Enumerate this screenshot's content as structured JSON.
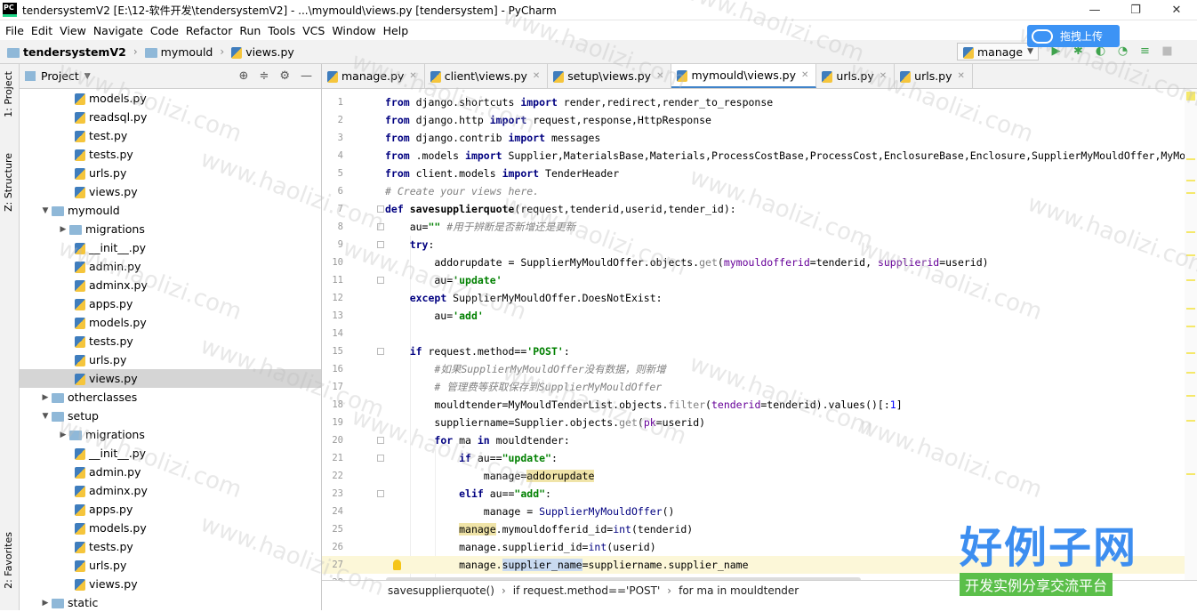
{
  "window": {
    "title": "tendersystemV2 [E:\\12-软件开发\\tendersystemV2] - ...\\mymould\\views.py [tendersystem] - PyCharm",
    "logo_text": "PC"
  },
  "menu": [
    "File",
    "Edit",
    "View",
    "Navigate",
    "Code",
    "Refactor",
    "Run",
    "Tools",
    "VCS",
    "Window",
    "Help"
  ],
  "navbar": {
    "crumbs": [
      "tendersystemV2",
      "mymould",
      "views.py"
    ],
    "run_config": "manage",
    "upload_badge": "拖拽上传"
  },
  "left_strip": {
    "tabs": [
      "1: Project",
      "Z: Structure",
      "2: Favorites"
    ]
  },
  "project_panel": {
    "title": "Project",
    "tree": [
      {
        "label": "models.py",
        "indent": 3,
        "type": "py"
      },
      {
        "label": "readsql.py",
        "indent": 3,
        "type": "py"
      },
      {
        "label": "test.py",
        "indent": 3,
        "type": "py"
      },
      {
        "label": "tests.py",
        "indent": 3,
        "type": "py"
      },
      {
        "label": "urls.py",
        "indent": 3,
        "type": "py"
      },
      {
        "label": "views.py",
        "indent": 3,
        "type": "py"
      },
      {
        "label": "mymould",
        "indent": 1,
        "type": "folder",
        "arrow": "open"
      },
      {
        "label": "migrations",
        "indent": 2,
        "type": "folder",
        "arrow": "closed"
      },
      {
        "label": "__init__.py",
        "indent": 3,
        "type": "py"
      },
      {
        "label": "admin.py",
        "indent": 3,
        "type": "py"
      },
      {
        "label": "adminx.py",
        "indent": 3,
        "type": "py"
      },
      {
        "label": "apps.py",
        "indent": 3,
        "type": "py"
      },
      {
        "label": "models.py",
        "indent": 3,
        "type": "py"
      },
      {
        "label": "tests.py",
        "indent": 3,
        "type": "py"
      },
      {
        "label": "urls.py",
        "indent": 3,
        "type": "py"
      },
      {
        "label": "views.py",
        "indent": 3,
        "type": "py",
        "selected": true
      },
      {
        "label": "otherclasses",
        "indent": 1,
        "type": "folder",
        "arrow": "closed"
      },
      {
        "label": "setup",
        "indent": 1,
        "type": "folder",
        "arrow": "open"
      },
      {
        "label": "migrations",
        "indent": 2,
        "type": "folder",
        "arrow": "closed"
      },
      {
        "label": "__init__.py",
        "indent": 3,
        "type": "py"
      },
      {
        "label": "admin.py",
        "indent": 3,
        "type": "py"
      },
      {
        "label": "adminx.py",
        "indent": 3,
        "type": "py"
      },
      {
        "label": "apps.py",
        "indent": 3,
        "type": "py"
      },
      {
        "label": "models.py",
        "indent": 3,
        "type": "py"
      },
      {
        "label": "tests.py",
        "indent": 3,
        "type": "py"
      },
      {
        "label": "urls.py",
        "indent": 3,
        "type": "py"
      },
      {
        "label": "views.py",
        "indent": 3,
        "type": "py"
      },
      {
        "label": "static",
        "indent": 1,
        "type": "folder",
        "arrow": "closed"
      }
    ]
  },
  "editor": {
    "tabs": [
      {
        "label": "manage.py",
        "active": false
      },
      {
        "label": "client\\views.py",
        "active": false
      },
      {
        "label": "setup\\views.py",
        "active": false
      },
      {
        "label": "mymould\\views.py",
        "active": true
      },
      {
        "label": "urls.py",
        "active": false
      },
      {
        "label": "urls.py",
        "active": false
      }
    ],
    "current_line": 27,
    "breadcrumb": [
      "savesupplierquote()",
      "if request.method=='POST'",
      "for ma in mouldtender"
    ]
  },
  "watermark": {
    "text": "www.haolizi.com",
    "logo_big": "好例子网",
    "logo_small": "开发实例分享交流平台"
  }
}
